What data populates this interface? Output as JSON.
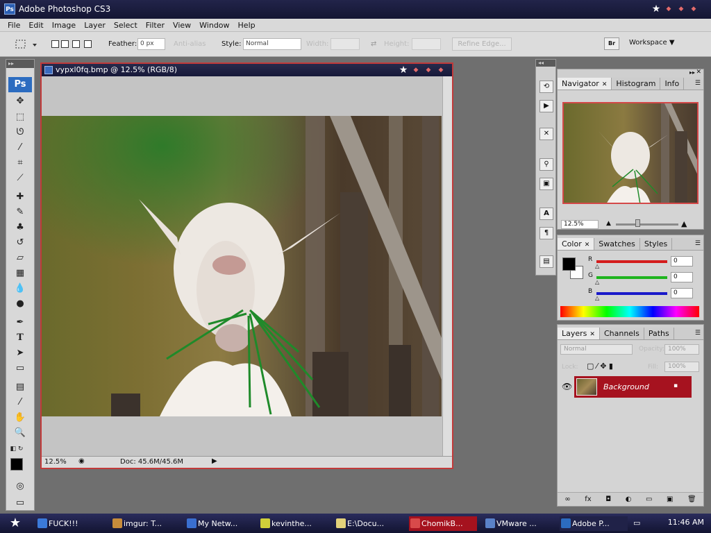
{
  "app": {
    "title": "Adobe Photoshop CS3",
    "icon": "Ps"
  },
  "menu": [
    "File",
    "Edit",
    "Image",
    "Layer",
    "Select",
    "Filter",
    "View",
    "Window",
    "Help"
  ],
  "options": {
    "feather_label": "Feather:",
    "feather_value": "0 px",
    "antialias_label": "Anti-alias",
    "style_label": "Style:",
    "style_value": "Normal",
    "width_label": "Width:",
    "height_label": "Height:",
    "refine_edge": "Refine Edge...",
    "workspace": "Workspace"
  },
  "toolbox": {
    "logo": "Ps",
    "icons": [
      "move-icon",
      "marquee-icon",
      "lasso-icon",
      "magic-wand-icon",
      "crop-icon",
      "slice-icon",
      "healing-brush-icon",
      "brush-icon",
      "clone-stamp-icon",
      "history-brush-icon",
      "eraser-icon",
      "gradient-icon",
      "blur-icon",
      "dodge-icon",
      "pen-icon",
      "type-icon",
      "path-selection-icon",
      "rectangle-icon",
      "notes-icon",
      "eyedropper-icon",
      "hand-icon",
      "zoom-icon"
    ]
  },
  "document": {
    "title": "vypxl0fq.bmp @ 12.5% (RGB/8)",
    "zoom": "12.5%",
    "info": "Doc: 45.6M/45.6M"
  },
  "navigator": {
    "tabs": [
      "Navigator",
      "Histogram",
      "Info"
    ],
    "zoom": "12.5%"
  },
  "color": {
    "tabs": [
      "Color",
      "Swatches",
      "Styles"
    ],
    "channels": [
      {
        "label": "R",
        "value": "0",
        "color": "#d41c1c"
      },
      {
        "label": "G",
        "value": "0",
        "color": "#1fb41f"
      },
      {
        "label": "B",
        "value": "0",
        "color": "#1a1ac9"
      }
    ]
  },
  "layers": {
    "tabs": [
      "Layers",
      "Channels",
      "Paths"
    ],
    "blend_mode": "Normal",
    "opacity_label": "Opacity:",
    "opacity": "100%",
    "lock_label": "Lock:",
    "fill_label": "Fill:",
    "fill": "100%",
    "layer_name": "Background"
  },
  "taskbar": {
    "items": [
      {
        "label": "FUCK!!!",
        "color": "#3b7ad9"
      },
      {
        "label": "imgur: T...",
        "color": "#c78c3b"
      },
      {
        "label": "My Netw...",
        "color": "#3a6fd0"
      },
      {
        "label": "kevinthe...",
        "color": "#cfcf3a"
      },
      {
        "label": "E:\\Docu...",
        "color": "#e3d27a"
      },
      {
        "label": "ChomikB...",
        "color": "#d84a4a"
      },
      {
        "label": "VMware ...",
        "color": "#5a82c9"
      },
      {
        "label": "Adobe P...",
        "color": "#2c6cc0"
      }
    ],
    "clock": "11:46 AM"
  },
  "colors": {
    "accent_red": "#a6121f",
    "title_bar": "#1b1d3e"
  }
}
